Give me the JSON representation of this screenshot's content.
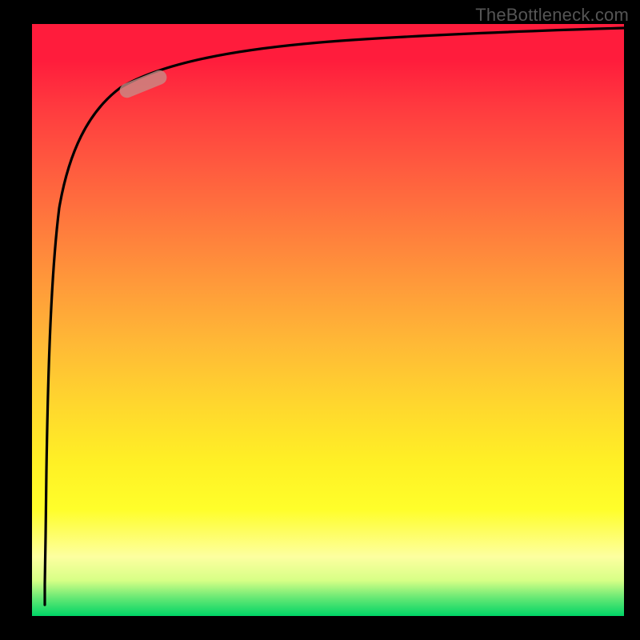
{
  "watermark": "TheBottleneck.com",
  "colors": {
    "background": "#000000",
    "curve_stroke": "#000000",
    "watermark_text": "#555555",
    "highlight_fill": "#c78d88",
    "gradient_top": "#ff1c3c",
    "gradient_mid1": "#ff9a3a",
    "gradient_mid2": "#fffe2a",
    "gradient_bottom": "#00d466"
  },
  "chart_data": {
    "type": "line",
    "title": "",
    "xlabel": "",
    "ylabel": "",
    "xlim": [
      0,
      100
    ],
    "ylim": [
      0,
      100
    ],
    "grid": false,
    "legend": false,
    "notes": "No numeric axis ticks or labels are shown. Values are estimated from pixel positions. y is roughly 100 - 100/x (%), producing a steep rise near x≈0 that plateaus near y≈100 as x grows.",
    "series": [
      {
        "name": "bottleneck_curve",
        "x": [
          1,
          2,
          3,
          4,
          6,
          8,
          10,
          14,
          20,
          30,
          50,
          70,
          100
        ],
        "y": [
          0,
          50,
          66.7,
          75,
          83.3,
          87.5,
          90,
          92.9,
          95,
          96.7,
          98,
          98.6,
          99
        ]
      }
    ],
    "highlight_segment": {
      "x_range": [
        13,
        21
      ],
      "y_range": [
        91,
        93.5
      ],
      "description": "Short translucent pink pill overlaying the curve near the upper-left bend."
    },
    "background_gradient": {
      "direction": "vertical",
      "stops": [
        {
          "pos": 0.0,
          "color": "#ff1c3c"
        },
        {
          "pos": 0.44,
          "color": "#ff9a3a"
        },
        {
          "pos": 0.82,
          "color": "#fffe2a"
        },
        {
          "pos": 1.0,
          "color": "#00d466"
        }
      ]
    }
  }
}
